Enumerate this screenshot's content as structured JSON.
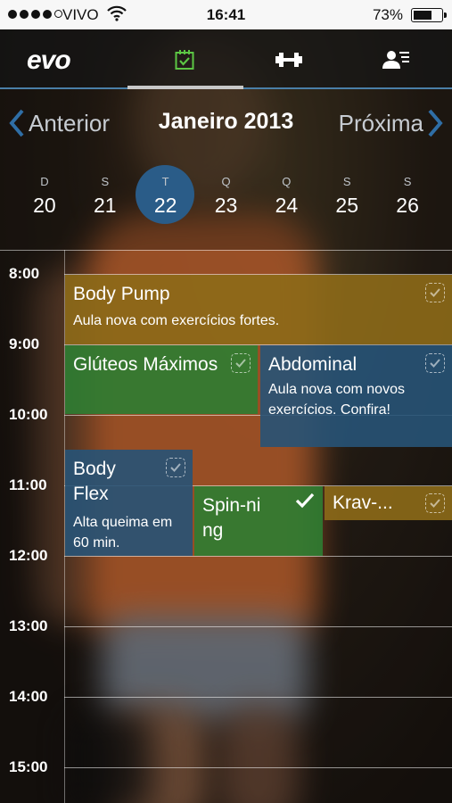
{
  "status_bar": {
    "carrier": "VIVO",
    "time": "16:41",
    "battery": "73%",
    "battery_level": 0.73
  },
  "nav": {
    "logo": "evo",
    "tabs": [
      {
        "icon": "calendar-check-icon",
        "active": true
      },
      {
        "icon": "dumbbell-icon",
        "active": false
      },
      {
        "icon": "user-list-icon",
        "active": false
      }
    ],
    "accent": "#4a7fa8"
  },
  "month": {
    "prev_label": "Anterior",
    "title": "Janeiro 2013",
    "next_label": "Próxima"
  },
  "days": [
    {
      "weekday": "D",
      "number": "20"
    },
    {
      "weekday": "S",
      "number": "21"
    },
    {
      "weekday": "T",
      "number": "22",
      "selected": true
    },
    {
      "weekday": "Q",
      "number": "23"
    },
    {
      "weekday": "Q",
      "number": "24"
    },
    {
      "weekday": "S",
      "number": "25"
    },
    {
      "weekday": "S",
      "number": "26"
    }
  ],
  "hours": [
    "8:00",
    "9:00",
    "10:00",
    "11:00",
    "12:00",
    "13:00",
    "14:00",
    "15:00"
  ],
  "events": [
    {
      "title": "Body Pump",
      "desc": "Aula nova com exercícios fortes.",
      "color": "#8d6a18",
      "start": "8:00",
      "end": "9:00",
      "checked": false
    },
    {
      "title": "Glúteos Máximos",
      "desc": "",
      "color": "#2e7d32",
      "start": "9:00",
      "end": "10:00",
      "checked": false
    },
    {
      "title": "Abdominal",
      "desc": "Aula nova com novos exercícios. Confira!",
      "color": "#275377",
      "start": "9:00",
      "end": "10:30",
      "checked": false
    },
    {
      "title": "Body Flex",
      "desc": "Alta queima em 60 min.",
      "color": "#275377",
      "start": "10:30",
      "end": "12:00",
      "checked": false
    },
    {
      "title": "Spin-ning",
      "desc": "",
      "color": "#2e7d32",
      "start": "11:00",
      "end": "12:00",
      "checked": true
    },
    {
      "title": "Krav-...",
      "desc": "",
      "color": "#8d6a18",
      "start": "11:00",
      "end": "11:30",
      "checked": false
    }
  ]
}
